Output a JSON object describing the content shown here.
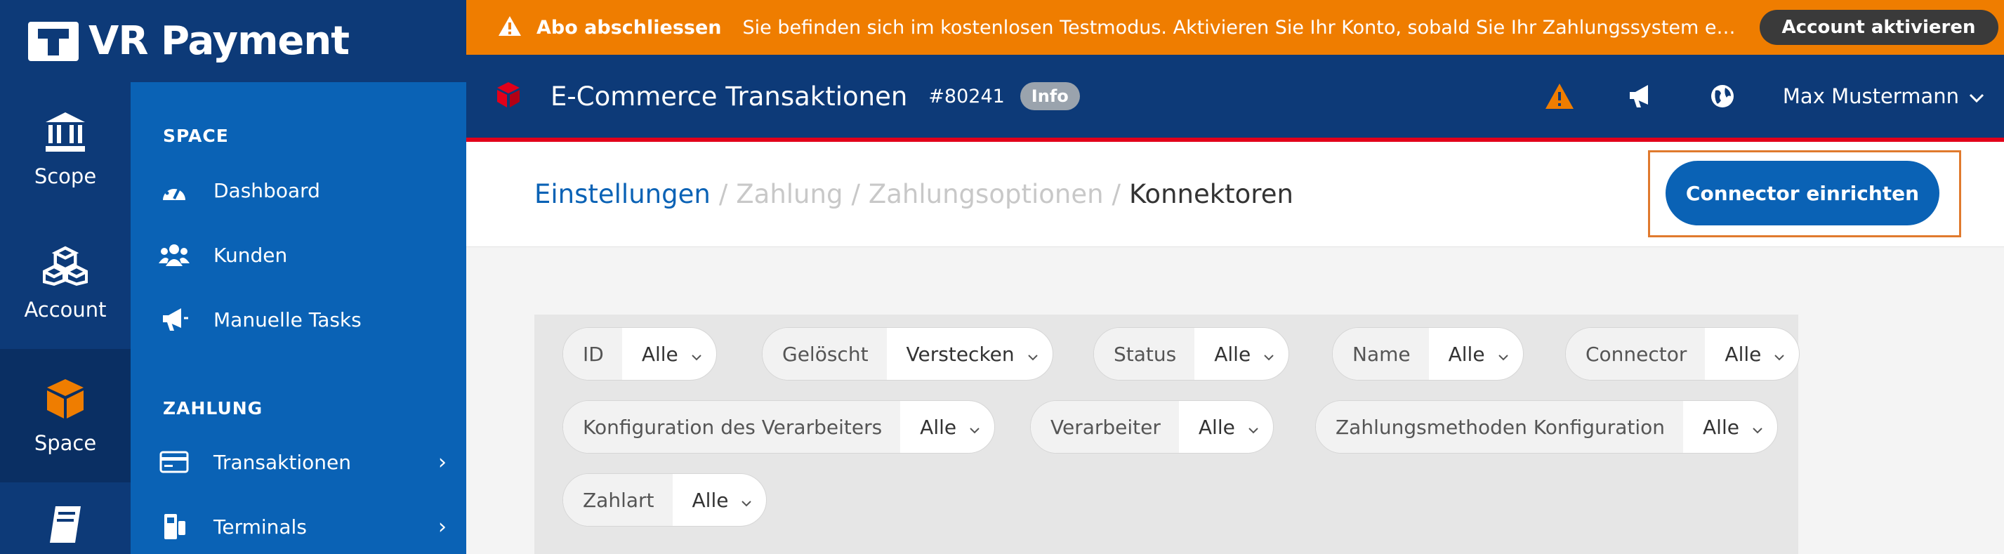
{
  "brand": {
    "name": "VR Payment"
  },
  "rail": {
    "items": [
      {
        "label": "Scope",
        "icon": "bank-icon"
      },
      {
        "label": "Account",
        "icon": "cubes-icon"
      },
      {
        "label": "Space",
        "icon": "cube-icon",
        "active": true
      },
      {
        "label": "",
        "icon": "book-icon"
      }
    ]
  },
  "sidebar": {
    "sections": [
      {
        "title": "SPACE",
        "items": [
          {
            "label": "Dashboard",
            "icon": "dashboard-icon"
          },
          {
            "label": "Kunden",
            "icon": "users-icon"
          },
          {
            "label": "Manuelle Tasks",
            "icon": "megaphone-icon"
          }
        ]
      },
      {
        "title": "ZAHLUNG",
        "items": [
          {
            "label": "Transaktionen",
            "icon": "credit-card-icon",
            "chevron": "›"
          },
          {
            "label": "Terminals",
            "icon": "terminal-icon",
            "chevron": "›"
          }
        ]
      }
    ]
  },
  "banner": {
    "title": "Abo abschliessen",
    "message": "Sie befinden sich im kostenlosen Testmodus. Aktivieren Sie Ihr Konto, sobald Sie Ihr Zahlungssystem ein…",
    "button": "Account aktivieren"
  },
  "header": {
    "title": "E-Commerce Transaktionen",
    "code": "#80241",
    "badge": "Info",
    "user": "Max Mustermann"
  },
  "breadcrumb": {
    "items": [
      "Einstellungen",
      "Zahlung",
      "Zahlungsoptionen",
      "Konnektoren"
    ],
    "separator": "/"
  },
  "actions": {
    "primary": "Connector einrichten"
  },
  "filters": [
    {
      "key": "ID",
      "value": "Alle"
    },
    {
      "key": "Gelöscht",
      "value": "Verstecken"
    },
    {
      "key": "Status",
      "value": "Alle"
    },
    {
      "key": "Name",
      "value": "Alle"
    },
    {
      "key": "Connector",
      "value": "Alle"
    },
    {
      "key": "Konfiguration des Verarbeiters",
      "value": "Alle"
    },
    {
      "key": "Verarbeiter",
      "value": "Alle"
    },
    {
      "key": "Zahlungsmethoden Konfiguration",
      "value": "Alle"
    },
    {
      "key": "Zahlart",
      "value": "Alle"
    }
  ],
  "colors": {
    "navy": "#0d3a78",
    "blue": "#0a62b5",
    "orange": "#ef7d00",
    "red": "#e2001a",
    "highlight": "#e07a2e"
  }
}
